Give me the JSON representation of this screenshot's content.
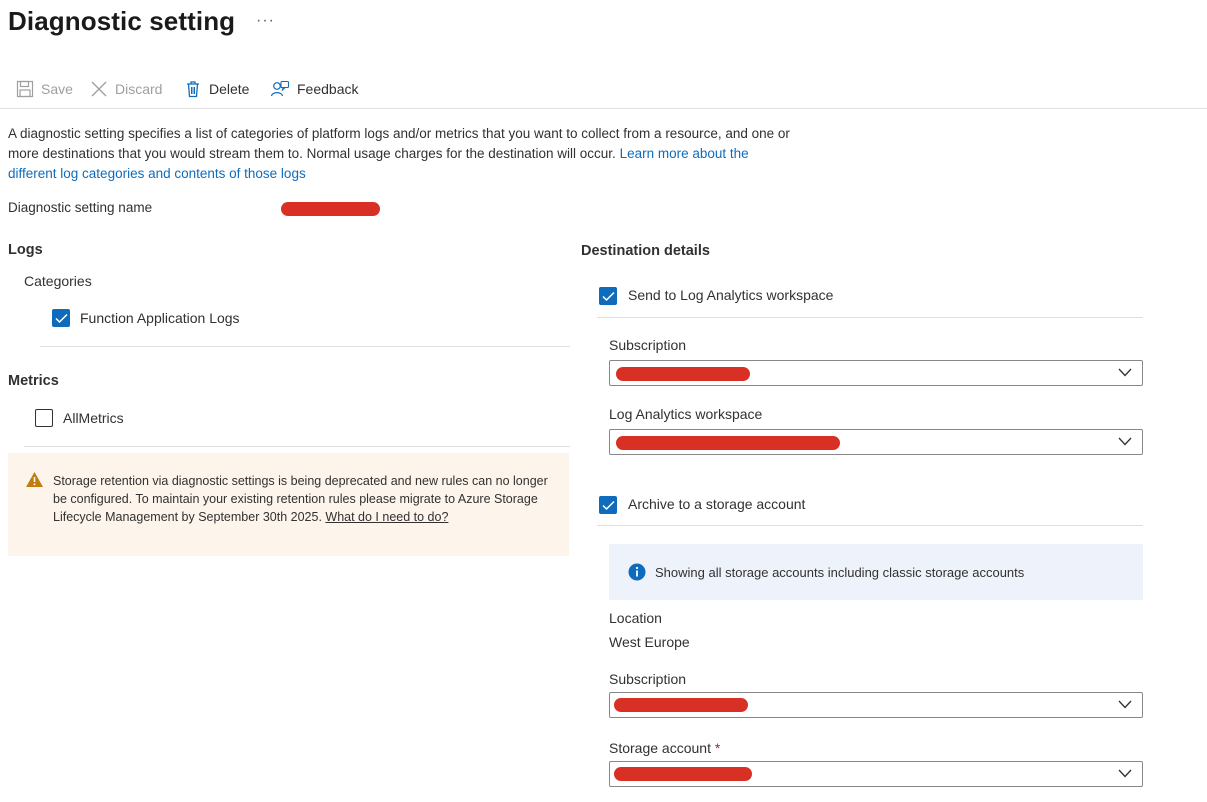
{
  "page": {
    "title": "Diagnostic setting",
    "more_label": "···"
  },
  "toolbar": {
    "save_label": "Save",
    "discard_label": "Discard",
    "delete_label": "Delete",
    "feedback_label": "Feedback"
  },
  "description": {
    "text": "A diagnostic setting specifies a list of categories of platform logs and/or metrics that you want to collect from a resource, and one or more destinations that you would stream them to. Normal usage charges for the destination will occur.",
    "link_text": "Learn more about the different log categories and contents of those logs"
  },
  "setting_name": {
    "label": "Diagnostic setting name"
  },
  "logs": {
    "heading": "Logs",
    "categories_label": "Categories",
    "items": [
      {
        "label": "Function Application Logs",
        "checked": true
      }
    ]
  },
  "metrics": {
    "heading": "Metrics",
    "items": [
      {
        "label": "AllMetrics",
        "checked": false
      }
    ]
  },
  "warning": {
    "text": "Storage retention via diagnostic settings is being deprecated and new rules can no longer be configured. To maintain your existing retention rules please migrate to Azure Storage Lifecycle Management by September 30th 2025.",
    "link_text": "What do I need to do?"
  },
  "destination": {
    "heading": "Destination details",
    "log_analytics": {
      "label": "Send to Log Analytics workspace",
      "checked": true,
      "subscription_label": "Subscription",
      "workspace_label": "Log Analytics workspace"
    },
    "storage": {
      "label": "Archive to a storage account",
      "checked": true,
      "info_text": "Showing all storage accounts including classic storage accounts",
      "location_label": "Location",
      "location_value": "West Europe",
      "subscription_label": "Subscription",
      "storage_account_label": "Storage account",
      "required_mark": "*"
    }
  },
  "colors": {
    "accent": "#0f6cbd",
    "redaction": "#d93025",
    "warning_bg": "#fdf4ec",
    "warning_icon": "#c27d0e",
    "info_bg": "#eef3fb"
  }
}
